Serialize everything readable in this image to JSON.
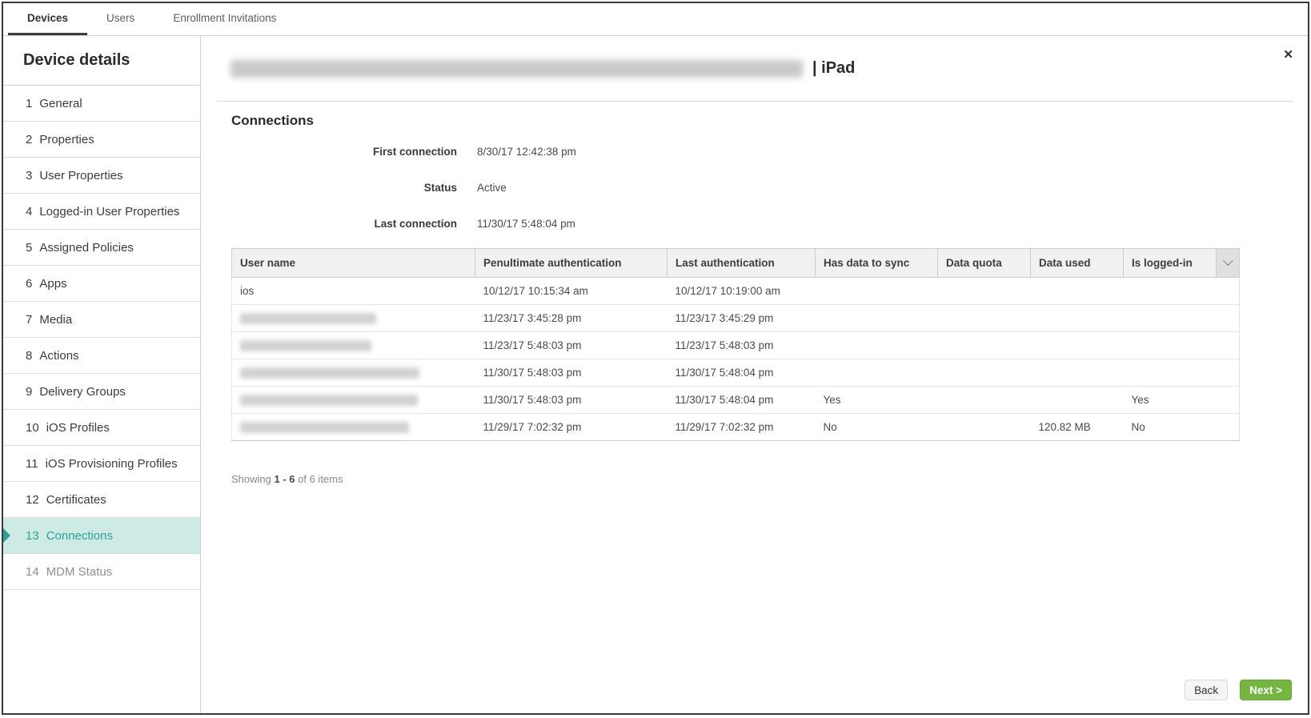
{
  "tabbar": {
    "tabs": [
      {
        "label": "Devices",
        "active": true
      },
      {
        "label": "Users",
        "active": false
      },
      {
        "label": "Enrollment Invitations",
        "active": false
      }
    ]
  },
  "sidebar": {
    "title": "Device details",
    "items": [
      {
        "num": "1",
        "label": "General"
      },
      {
        "num": "2",
        "label": "Properties"
      },
      {
        "num": "3",
        "label": "User Properties"
      },
      {
        "num": "4",
        "label": "Logged-in User Properties"
      },
      {
        "num": "5",
        "label": "Assigned Policies"
      },
      {
        "num": "6",
        "label": "Apps"
      },
      {
        "num": "7",
        "label": "Media"
      },
      {
        "num": "8",
        "label": "Actions"
      },
      {
        "num": "9",
        "label": "Delivery Groups"
      },
      {
        "num": "10",
        "label": "iOS Profiles"
      },
      {
        "num": "11",
        "label": "iOS Provisioning Profiles"
      },
      {
        "num": "12",
        "label": "Certificates"
      },
      {
        "num": "13",
        "label": "Connections",
        "selected": true
      },
      {
        "num": "14",
        "label": "MDM Status",
        "dimmed": true
      }
    ]
  },
  "header": {
    "device_name_redacted": true,
    "title_suffix": "| iPad",
    "close_icon": "✕"
  },
  "connections": {
    "heading": "Connections",
    "fields": [
      {
        "label": "First connection",
        "value": "8/30/17 12:42:38 pm"
      },
      {
        "label": "Status",
        "value": "Active"
      },
      {
        "label": "Last connection",
        "value": "11/30/17 5:48:04 pm"
      }
    ]
  },
  "table": {
    "columns": [
      "User name",
      "Penultimate authentication",
      "Last authentication",
      "Has data to sync",
      "Data quota",
      "Data used",
      "Is logged-in"
    ],
    "rows": [
      {
        "user_name": "ios",
        "redacted": false,
        "penultimate": "10/12/17 10:15:34 am",
        "last": "10/12/17 10:19:00 am",
        "has_data_to_sync": "",
        "data_quota": "",
        "data_used": "",
        "is_logged_in": ""
      },
      {
        "user_name": "",
        "redacted": true,
        "penultimate": "11/23/17 3:45:28 pm",
        "last": "11/23/17 3:45:29 pm",
        "has_data_to_sync": "",
        "data_quota": "",
        "data_used": "",
        "is_logged_in": ""
      },
      {
        "user_name": "",
        "redacted": true,
        "penultimate": "11/23/17 5:48:03 pm",
        "last": "11/23/17 5:48:03 pm",
        "has_data_to_sync": "",
        "data_quota": "",
        "data_used": "",
        "is_logged_in": ""
      },
      {
        "user_name": "",
        "redacted": true,
        "penultimate": "11/30/17 5:48:03 pm",
        "last": "11/30/17 5:48:04 pm",
        "has_data_to_sync": "",
        "data_quota": "",
        "data_used": "",
        "is_logged_in": ""
      },
      {
        "user_name": "",
        "redacted": true,
        "penultimate": "11/30/17 5:48:03 pm",
        "last": "11/30/17 5:48:04 pm",
        "has_data_to_sync": "Yes",
        "data_quota": "",
        "data_used": "",
        "is_logged_in": "Yes"
      },
      {
        "user_name": "",
        "redacted": true,
        "penultimate": "11/29/17 7:02:32 pm",
        "last": "11/29/17 7:02:32 pm",
        "has_data_to_sync": "No",
        "data_quota": "",
        "data_used": "120.82 MB",
        "is_logged_in": "No"
      }
    ]
  },
  "pagination": {
    "prefix": "Showing",
    "range": "1 - 6",
    "suffix": "of 6 items"
  },
  "footer": {
    "back_label": "Back",
    "next_label": "Next >"
  },
  "icons": {
    "close": "✕",
    "chevron_down": "⌄"
  },
  "colors": {
    "accent_teal_text": "#2fa198",
    "accent_teal_bg": "#cdeae5",
    "next_button_green": "#77b543"
  }
}
